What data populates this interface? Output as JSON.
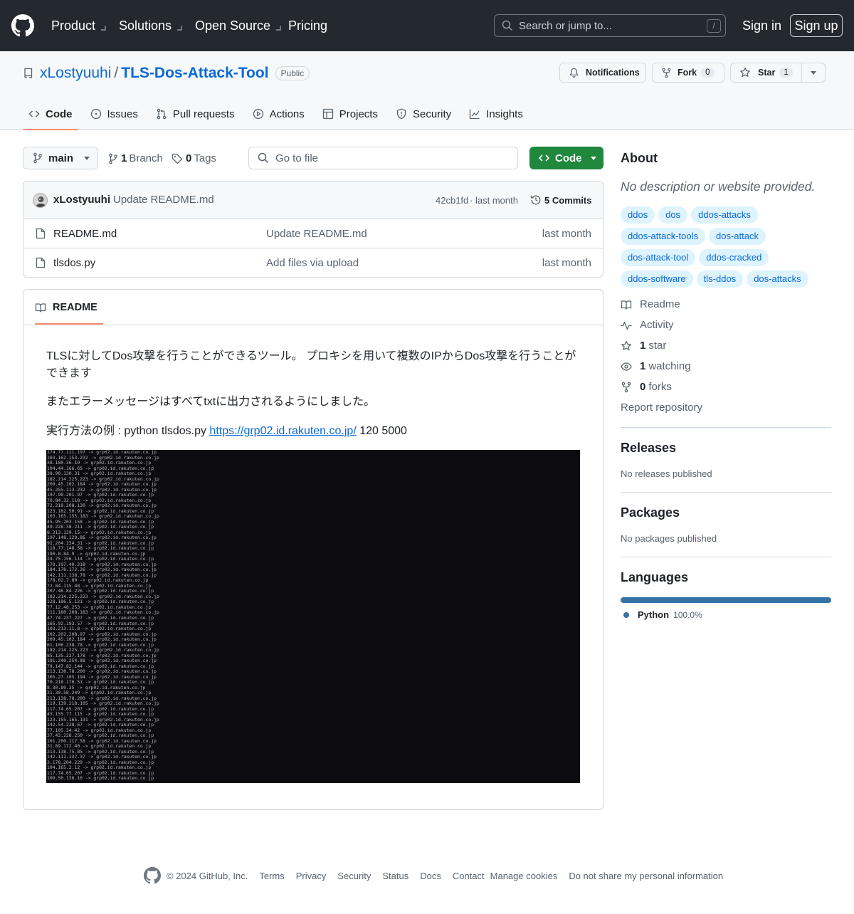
{
  "header": {
    "nav": [
      "Product",
      "Solutions",
      "Open Source",
      "Pricing"
    ],
    "search_placeholder": "Search or jump to...",
    "search_key": "/",
    "sign_in": "Sign in",
    "sign_up": "Sign up"
  },
  "repo": {
    "owner": "xLostyuuhi",
    "separator": "/",
    "name": "TLS-Dos-Attack-Tool",
    "visibility": "Public",
    "notifications_label": "Notifications",
    "fork_label": "Fork",
    "fork_count": "0",
    "star_label": "Star",
    "star_count": "1"
  },
  "tabs": [
    {
      "label": "Code",
      "icon": "code-icon",
      "active": true
    },
    {
      "label": "Issues",
      "icon": "issue-icon"
    },
    {
      "label": "Pull requests",
      "icon": "pull-request-icon"
    },
    {
      "label": "Actions",
      "icon": "play-icon"
    },
    {
      "label": "Projects",
      "icon": "table-icon"
    },
    {
      "label": "Security",
      "icon": "shield-icon"
    },
    {
      "label": "Insights",
      "icon": "graph-icon"
    }
  ],
  "toolbar": {
    "branch": "main",
    "branch_count": "1",
    "branch_label": "Branch",
    "tag_count": "0",
    "tag_label": "Tags",
    "goto_file_placeholder": "Go to file",
    "code_button": "Code"
  },
  "latest_commit": {
    "author": "xLostyuuhi",
    "message": "Update README.md",
    "hash": "42cb1fd",
    "dot": "·",
    "time": "last month",
    "commits_label": "5 Commits"
  },
  "files": [
    {
      "name": "README.md",
      "message": "Update README.md",
      "time": "last month"
    },
    {
      "name": "tlsdos.py",
      "message": "Add files via upload",
      "time": "last month"
    }
  ],
  "readme": {
    "tab_label": "README",
    "para1": "TLSに対してDos攻撃を行うことができるツール。 プロキシを用いて複数のIPからDos攻撃を行うことができます",
    "para2": "またエラーメッセージはすべてtxtに出力されるようにしました。",
    "para3_prefix": "実行方法の例 : python tlsdos.py ",
    "para3_link": "https://grp02.id.rakuten.co.jp/",
    "para3_suffix": " 120 5000",
    "terminal_lines": [
      "174.77.111.197 -> grp02.id.rakuten.co.jp",
      "103.162.153.232 -> grp02.id.rakuten.co.jp",
      "38.180.36.19 -> grp02.id.rakuten.co.jp",
      "104.44.166.65 -> grp02.id.rakuten.co.jp",
      "38.90.130.31 -> grp02.id.rakuten.co.jp",
      "182.214.225.223 -> grp02.id.rakuten.co.jp",
      "209.45.102.184 -> grp02.id.rakuten.co.jp",
      "45.255.113.232 -> grp02.id.rakuten.co.jp",
      "197.90.201.97 -> grp02.id.rakuten.co.jp",
      "70.84.32.118 -> grp02.id.rakuten.co.jp",
      "72.218.208.130 -> grp02.id.rakuten.co.jp",
      "123.182.50.91 -> grp02.id.rakuten.co.jp",
      "103.165.155.183 -> grp02.id.rakuten.co.jp",
      "45.95.203.158 -> grp02.id.rakuten.co.jp",
      "49.228.38.211 -> grp02.id.rakuten.co.jp",
      "8.213.129.15 -> grp02.id.rakuten.co.jp",
      "197.148.129.86 -> grp02.id.rakuten.co.jp",
      "91.204.134.31 -> grp02.id.rakuten.co.jp",
      "118.77.148.58 -> grp02.id.rakuten.co.jp",
      "190.8.84.9 -> grp02.id.rakuten.co.jp",
      "24.75.156.114 -> grp02.id.rakuten.co.jp",
      "170.197.40.218 -> grp02.id.rakuten.co.jp",
      "184.178.172.26 -> grp02.id.rakuten.co.jp",
      "142.111.138.78 -> grp02.id.rakuten.co.jp",
      "178.62.7.80 -> grp02.id.rakuten.co.jp",
      "72.84.115.48 -> grp02.id.rakuten.co.jp",
      "207.46.84.226 -> grp02.id.rakuten.co.jp",
      "182.214.225.223 -> grp02.id.rakuten.co.jp",
      "128.186.5.121 -> grp02.id.rakuten.co.jp",
      "77.12.48.253 -> grp02.id.rakuten.co.jp",
      "111.180.208.183 -> grp02.id.rakuten.co.jp",
      "47.74.237.227 -> grp02.id.rakuten.co.jp",
      "165.92.193.57 -> grp02.id.rakuten.co.jp",
      "103.213.11.8 -> grp02.id.rakuten.co.jp",
      "102.202.208.97 -> grp02.id.rakuten.co.jp",
      "209.45.102.184 -> grp02.id.rakuten.co.jp",
      "61.106.238.78 -> grp02.id.rakuten.co.jp",
      "182.214.225.223 -> grp02.id.rakuten.co.jp",
      "85.135.227.178 -> grp02.id.rakuten.co.jp",
      "191.240.254.88 -> grp02.id.rakuten.co.jp",
      "79.147.82.144 -> grp02.id.rakuten.co.jp",
      "213.138.78.200 -> grp02.id.rakuten.co.jp",
      "105.27.105.194 -> grp02.id.rakuten.co.jp",
      "70.218.176.51 -> grp02.id.rakuten.co.jp",
      "8.30.89.35 -> grp02.id.rakuten.co.jp",
      "31.30.58.249 -> grp02.id.rakuten.co.jp",
      "213.138.78.200 -> grp02.id.rakuten.co.jp",
      "119.139.218.105 -> grp02.id.rakuten.co.jp",
      "117.74.65.207 -> grp02.id.rakuten.co.jp",
      "43.155.77.115 -> grp02.id.rakuten.co.jp",
      "123.155.165.191 -> grp02.id.rakuten.co.jp",
      "142.54.238.67 -> grp02.id.rakuten.co.jp",
      "77.105.34.42 -> grp02.id.rakuten.co.jp",
      "37.43.228.250 -> grp02.id.rakuten.co.jp",
      "101.200.117.58 -> grp02.id.rakuten.co.jp",
      "31.89.172.40 -> grp02.id.rakuten.co.jp",
      "213.138.75.85 -> grp02.id.rakuten.co.jp",
      "142.111.137.37 -> grp02.id.rakuten.co.jp",
      "3.178.204.229 -> grp02.id.rakuten.co.jp",
      "104.165.2.12 -> grp02.id.rakuten.co.jp",
      "117.74.65.207 -> grp02.id.rakuten.co.jp",
      "109.50.136.10 -> grp02.id.rakuten.co.jp"
    ]
  },
  "about": {
    "title": "About",
    "description": "No description or website provided.",
    "topics": [
      "ddos",
      "dos",
      "ddos-attacks",
      "ddos-attack-tools",
      "dos-attack",
      "dos-attack-tool",
      "ddos-cracked",
      "ddos-software",
      "tls-ddos",
      "dos-attacks"
    ],
    "readme_label": "Readme",
    "activity_label": "Activity",
    "stars_count": "1",
    "stars_label": "star",
    "watching_count": "1",
    "watching_label": "watching",
    "forks_count": "0",
    "forks_label": "forks",
    "report": "Report repository"
  },
  "releases": {
    "title": "Releases",
    "empty": "No releases published"
  },
  "packages": {
    "title": "Packages",
    "empty": "No packages published"
  },
  "languages": {
    "title": "Languages",
    "items": [
      {
        "name": "Python",
        "percent": "100.0%",
        "color": "#3572A5"
      }
    ]
  },
  "footer": {
    "copyright": "© 2024 GitHub, Inc.",
    "links": [
      "Terms",
      "Privacy",
      "Security",
      "Status",
      "Docs",
      "Contact",
      "Manage cookies",
      "Do not share my personal information"
    ]
  },
  "colors": {
    "header_bg": "#24292f",
    "link": "#0969da",
    "primary_button": "#1f883d",
    "active_tab_underline": "#fd8c73"
  }
}
